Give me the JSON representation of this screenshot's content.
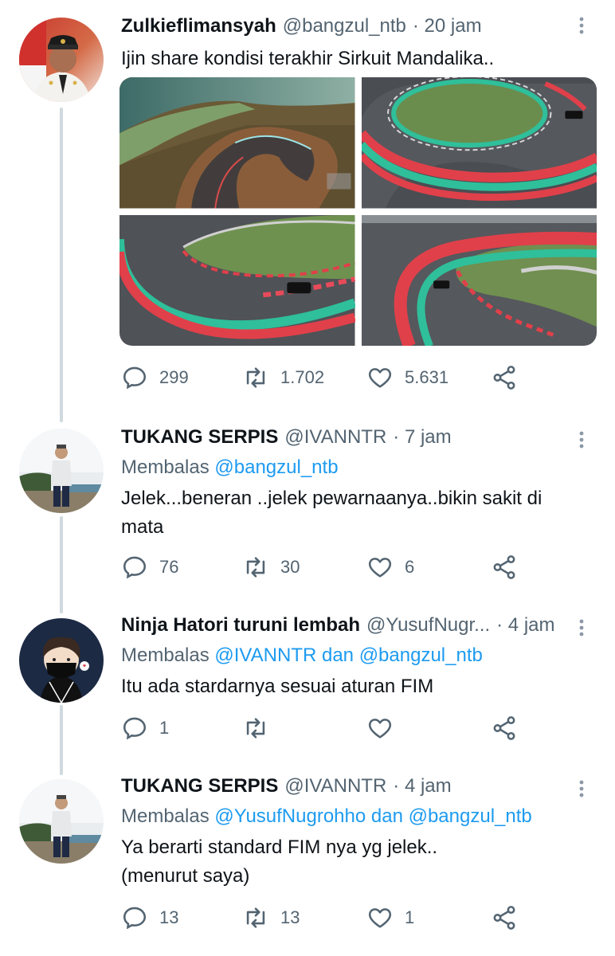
{
  "tweets": [
    {
      "name": "Zulkieflimansyah",
      "handle": "@bangzul_ntb",
      "time": "· 20 jam",
      "text": "Ijin share kondisi terakhir Sirkuit Mandalika..",
      "replies": "299",
      "retweets": "1.702",
      "likes": "5.631"
    },
    {
      "name": "TUKANG SERPIS",
      "handle": "@IVANNTR",
      "time": "· 7 jam",
      "reply_prefix": "Membalas",
      "reply_mentions": "@bangzul_ntb",
      "text": "Jelek...beneran ..jelek pewarnaanya..bikin sakit di mata",
      "replies": "76",
      "retweets": "30",
      "likes": "6"
    },
    {
      "name": "Ninja Hatori turuni lembah",
      "handle": "@YusufNugr...",
      "time": "· 4 jam",
      "reply_prefix": "Membalas",
      "reply_mentions": "@IVANNTR dan @bangzul_ntb",
      "text": "Itu ada stardarnya sesuai aturan FIM",
      "replies": "1",
      "retweets": "",
      "likes": ""
    },
    {
      "name": "TUKANG SERPIS",
      "handle": "@IVANNTR",
      "time": "· 4 jam",
      "reply_prefix": "Membalas",
      "reply_mentions": "@YusufNugrohho dan @bangzul_ntb",
      "text_line1": "Ya berarti standard FIM nya yg jelek..",
      "text_line2": "(menurut saya)",
      "replies": "13",
      "retweets": "13",
      "likes": "1"
    }
  ],
  "colors": {
    "text": "#0f1419",
    "secondary": "#536471",
    "link": "#1d9bf0",
    "thread_line": "#cfd9de"
  },
  "icons": [
    "reply-icon",
    "retweet-icon",
    "like-icon",
    "share-icon",
    "more-icon"
  ]
}
